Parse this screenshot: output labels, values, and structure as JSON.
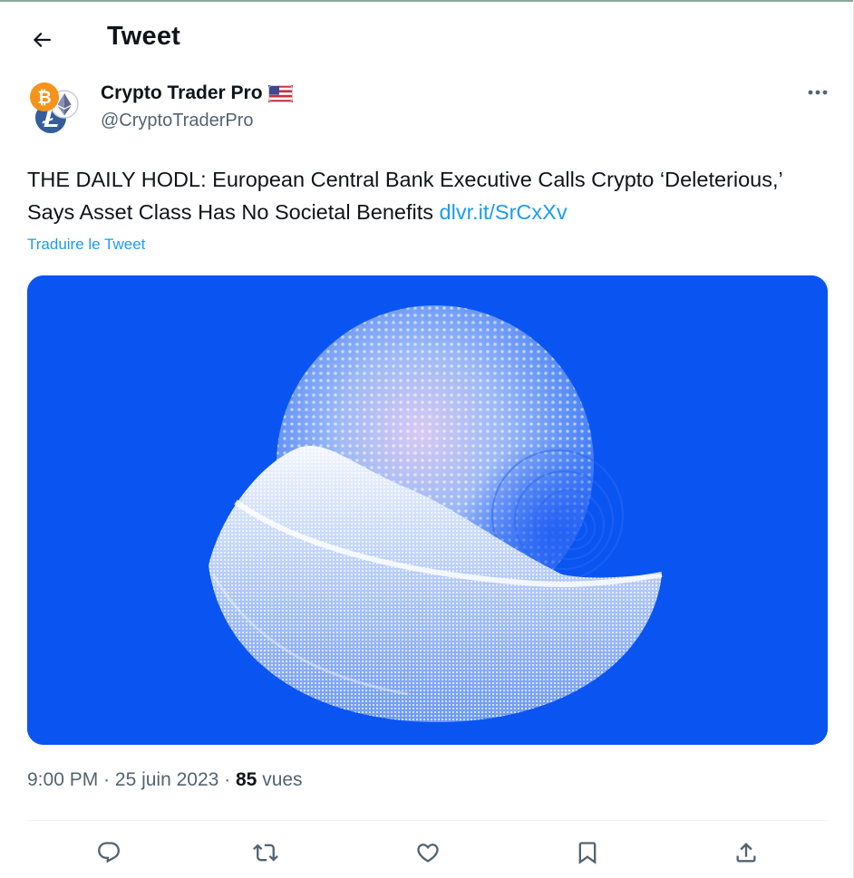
{
  "header": {
    "title": "Tweet"
  },
  "author": {
    "display_name": "Crypto Trader Pro",
    "handle": "@CryptoTraderPro",
    "flag_icon": "us-flag-icon"
  },
  "tweet": {
    "text": "THE DAILY HODL: European Central Bank Executive Calls Crypto ‘Deleterious,’ Says Asset Class Has No Societal Benefits ",
    "link": "dlvr.it/SrCxXv",
    "translate_label": "Traduire le Tweet"
  },
  "meta": {
    "time": "9:00 PM",
    "separator1": " · ",
    "date": "25 juin 2023",
    "separator2": " · ",
    "views_count": "85",
    "views_label": " vues"
  },
  "colors": {
    "accent": "#1d9bf0",
    "media_bg": "#0a55f2",
    "secondary_text": "#536471",
    "bitcoin": "#f7931a",
    "litecoin": "#345d9d"
  },
  "actions": [
    {
      "name": "reply-button",
      "icon": "reply-icon"
    },
    {
      "name": "retweet-button",
      "icon": "retweet-icon"
    },
    {
      "name": "like-button",
      "icon": "heart-icon"
    },
    {
      "name": "bookmark-button",
      "icon": "bookmark-icon"
    },
    {
      "name": "share-button",
      "icon": "share-icon"
    }
  ]
}
